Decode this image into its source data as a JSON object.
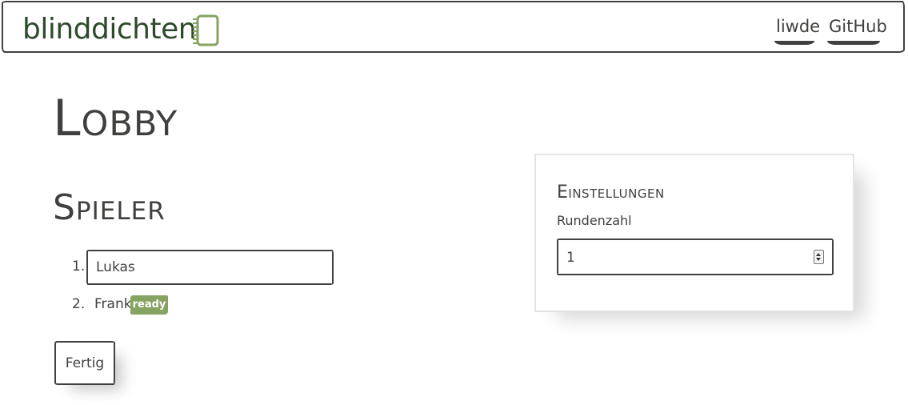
{
  "navbar": {
    "brand": "blinddichten",
    "brand_icon": "notebook-icon",
    "links": [
      {
        "label": "liwde"
      },
      {
        "label": "GitHub"
      }
    ]
  },
  "page": {
    "title": "Lobby",
    "players_heading": "Spieler"
  },
  "players": [
    {
      "number": "1.",
      "name": "Lukas",
      "editable": true
    },
    {
      "number": "2.",
      "name": "Frank",
      "badge": "ready"
    }
  ],
  "ready_button": "Fertig",
  "settings": {
    "title": "Einstellungen",
    "rounds_label": "Rundenzahl",
    "rounds_value": "1"
  },
  "colors": {
    "text": "#41403e",
    "brand": "#2e4a2b",
    "accent": "#86a361"
  }
}
